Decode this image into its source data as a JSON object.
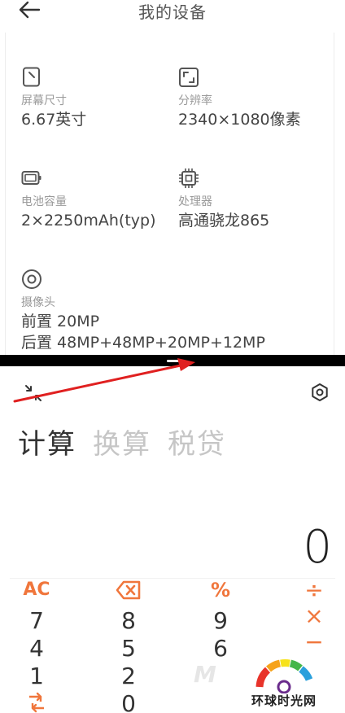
{
  "device_page": {
    "title": "我的设备",
    "specs": [
      {
        "icon": "screen-size-icon",
        "label": "屏幕尺寸",
        "value": "6.67英寸"
      },
      {
        "icon": "resolution-icon",
        "label": "分辨率",
        "value": "2340×1080像素"
      },
      {
        "icon": "battery-icon",
        "label": "电池容量",
        "value": "2×2250mAh(typ)"
      },
      {
        "icon": "processor-icon",
        "label": "处理器",
        "value": "高通骁龙865"
      },
      {
        "icon": "camera-icon",
        "label": "摄像头",
        "value": "前置 20MP",
        "value2": "后置 48MP+48MP+20MP+12MP"
      }
    ]
  },
  "calculator": {
    "tabs": [
      "计算",
      "换算",
      "税贷"
    ],
    "active_tab": "计算",
    "display": "0",
    "keys": {
      "ac": "AC",
      "percent": "%",
      "divide": "÷",
      "multiply": "×",
      "minus": "−",
      "seven": "7",
      "eight": "8",
      "nine": "9",
      "four": "4",
      "five": "5",
      "six": "6",
      "one": "1",
      "two": "2",
      "zero": "0"
    }
  },
  "watermark": {
    "text": "环球时光网"
  },
  "colors": {
    "accent": "#f0763c",
    "annotation_arrow": "#e02020",
    "divider": "#000000"
  }
}
